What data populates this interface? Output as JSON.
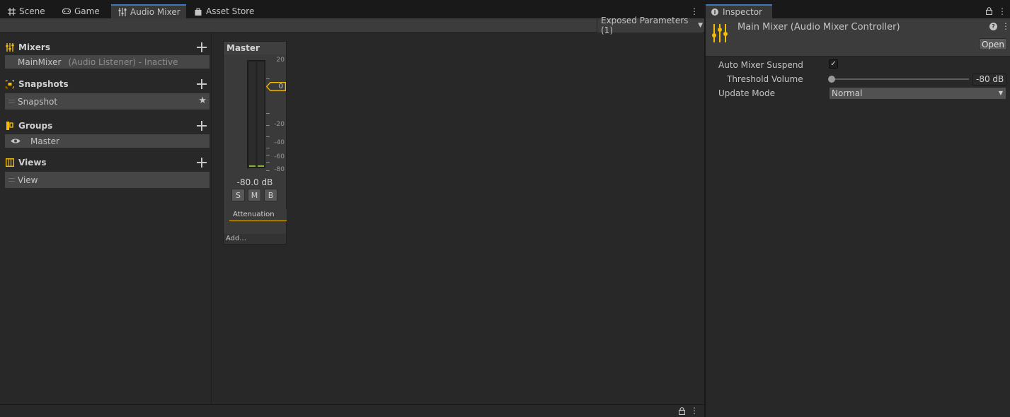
{
  "tabs": [
    {
      "label": "Scene",
      "icon": "grid-icon"
    },
    {
      "label": "Game",
      "icon": "gamepad-icon"
    },
    {
      "label": "Audio Mixer",
      "icon": "mixer-icon",
      "active": true
    },
    {
      "label": "Asset Store",
      "icon": "shopping-bag-icon"
    }
  ],
  "toolbar": {
    "exposed_parameters": "Exposed Parameters (1)"
  },
  "left_pane": {
    "mixers": {
      "title": "Mixers",
      "item_name": "MainMixer",
      "item_detail": "(Audio Listener) - Inactive"
    },
    "snapshots": {
      "title": "Snapshots",
      "item": "Snapshot"
    },
    "groups": {
      "title": "Groups",
      "item": "Master"
    },
    "views": {
      "title": "Views",
      "item": "View"
    }
  },
  "strip": {
    "title": "Master",
    "scale": [
      "20",
      "0",
      "-20",
      "-40",
      "-60",
      "-80"
    ],
    "fader_value": "0",
    "db_readout": "-80.0 dB",
    "buttons": [
      "S",
      "M",
      "B"
    ],
    "effect": "Attenuation",
    "add": "Add..."
  },
  "inspector": {
    "tab": "Inspector",
    "title": "Main Mixer (Audio Mixer Controller)",
    "open_button": "Open",
    "auto_mixer_suspend_label": "Auto Mixer Suspend",
    "auto_mixer_suspend": true,
    "threshold_label": "Threshold Volume",
    "threshold_value": "-80 dB",
    "update_mode_label": "Update Mode",
    "update_mode_value": "Normal"
  },
  "colors": {
    "accent": "#f4bc02",
    "tab_highlight": "#3a79bb",
    "meter": "#8ab23a"
  }
}
